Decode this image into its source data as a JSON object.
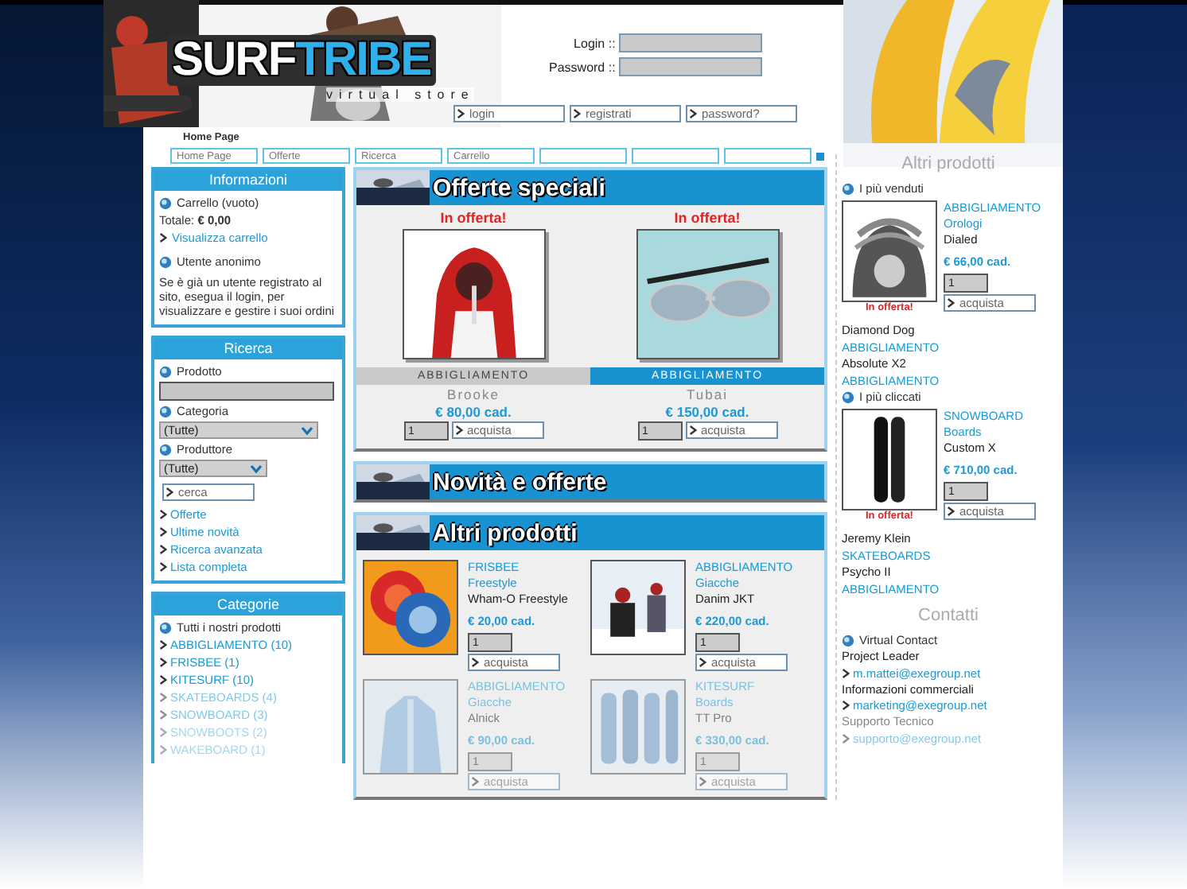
{
  "header": {
    "logo_left": "SURF",
    "logo_right": "TRIBE",
    "tagline": "virtual store",
    "login_label": "Login ::",
    "password_label": "Password ::",
    "buttons": [
      "login",
      "registrati",
      "password?"
    ],
    "location": "Home Page",
    "nav": [
      {
        "label": "Home Page"
      },
      {
        "label": "Offerte"
      },
      {
        "label": "Ricerca"
      },
      {
        "label": "Carrello"
      }
    ]
  },
  "info": {
    "title": "Informazioni",
    "cart": "Carrello (vuoto)",
    "total": "Totale: **€ 0,00**",
    "view_cart": "Visualizza carrello",
    "user": "Utente anonimo",
    "message": "Se è già un utente registrato al sito, esegua il login, per visualizzare e gestire i suoi ordini"
  },
  "search": {
    "title": "Ricerca",
    "product_label": "Prodotto",
    "category_label": "Categoria",
    "category_value": "(Tutte)",
    "producer_label": "Produttore",
    "producer_value": "(Tutte)",
    "button": "cerca",
    "links": [
      "Offerte",
      "Ultime novità",
      "Ricerca avanzata",
      "Lista completa"
    ]
  },
  "categories": {
    "title": "Categorie",
    "all": "Tutti i nostri prodotti",
    "items": [
      "ABBIGLIAMENTO (10)",
      "FRISBEE (1)",
      "KITESURF (10)",
      "SKATEBOARDS (4)",
      "SNOWBOARD (3)",
      "SNOWBOOTS (2)",
      "WAKEBOARD (1)"
    ]
  },
  "special_offers": {
    "title": "Offerte speciali",
    "items": [
      {
        "badge": "In offerta!",
        "category": "ABBIGLIAMENTO",
        "selected": false,
        "name": "Brooke",
        "price": "€ 80,00 cad.",
        "quantity": "1",
        "button": "acquista"
      },
      {
        "badge": "In offerta!",
        "category": "ABBIGLIAMENTO",
        "selected": true,
        "name": "Tubai",
        "price": "€ 150,00 cad.",
        "quantity": "1",
        "button": "acquista"
      }
    ]
  },
  "news_title": "Novità e offerte",
  "other_products": {
    "title": "Altri prodotti",
    "items": [
      {
        "category": "FRISBEE",
        "subcategory": "Freestyle",
        "name": "Wham-O Freestyle",
        "price": "€ 20,00 cad.",
        "quantity": "1",
        "button": "acquista"
      },
      {
        "category": "ABBIGLIAMENTO",
        "subcategory": "Giacche",
        "name": "Danim JKT",
        "price": "€ 220,00 cad.",
        "quantity": "1",
        "button": "acquista"
      },
      {
        "category": "ABBIGLIAMENTO",
        "subcategory": "Giacche",
        "name": "Alnick",
        "price": "€ 90,00 cad.",
        "quantity": "1",
        "button": "acquista"
      },
      {
        "category": "KITESURF",
        "subcategory": "Boards",
        "name": "TT Pro",
        "price": "€ 330,00 cad.",
        "quantity": "1",
        "button": "acquista"
      }
    ]
  },
  "sidebar": {
    "title": "Altri prodotti",
    "sections": [
      {
        "heading": "I più venduti",
        "featured": {
          "category": "ABBIGLIAMENTO",
          "subcategory": "Orologi",
          "name": "Dialed",
          "price": "€ 66,00 cad.",
          "badge": "In offerta!",
          "quantity": "1",
          "button": "acquista"
        },
        "list": [
          {
            "name": "Diamond Dog",
            "category": "ABBIGLIAMENTO"
          },
          {
            "name": "Absolute X2",
            "category": "ABBIGLIAMENTO"
          }
        ]
      },
      {
        "heading": "I più cliccati",
        "featured": {
          "category": "SNOWBOARD",
          "subcategory": "Boards",
          "name": "Custom X",
          "price": "€ 710,00 cad.",
          "badge": "In offerta!",
          "quantity": "1",
          "button": "acquista"
        },
        "list": [
          {
            "name": "Jeremy Klein",
            "category": "SKATEBOARDS"
          },
          {
            "name": "Psycho II",
            "category": "ABBIGLIAMENTO"
          }
        ]
      }
    ]
  },
  "contacts": {
    "title": "Contatti",
    "heading": "Virtual Contact",
    "entries": [
      {
        "role": "Project Leader",
        "email": "m.mattei@exegroup.net"
      },
      {
        "role": "Informazioni commerciali",
        "email": "marketing@exegroup.net"
      },
      {
        "role": "Supporto Tecnico",
        "email": "supporto@exegroup.net"
      }
    ]
  }
}
